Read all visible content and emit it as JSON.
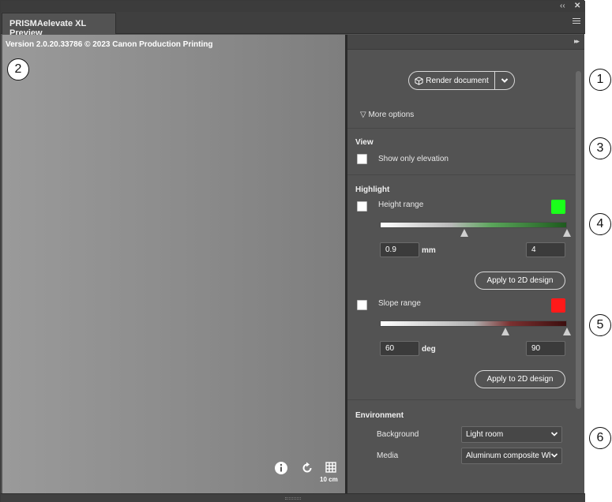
{
  "window": {
    "tab_title": "PRISMAelevate XL Preview",
    "titlebar_buttons": [
      "collapse-icon",
      "close-icon"
    ]
  },
  "preview": {
    "version_text": "Version 2.0.20.33786 © 2023 Canon Production Printing",
    "tool_icons": [
      "info-icon",
      "reset-view-icon",
      "grid-icon"
    ],
    "grid_scale_label": "10 cm"
  },
  "sidebar": {
    "render_button_label": "Render document",
    "more_options_label": "▽ More options",
    "view": {
      "title": "View",
      "show_only_elevation_label": "Show only elevation",
      "show_only_elevation_checked": false
    },
    "highlight": {
      "title": "Highlight",
      "height_range": {
        "label": "Height range",
        "checked": false,
        "color": "#1aff1a",
        "min_value": "0.9",
        "max_value": "4",
        "unit": "mm",
        "apply_label": "Apply to 2D design",
        "slider_min_fraction": 0.45,
        "slider_max_fraction": 1.0
      },
      "slope_range": {
        "label": "Slope range",
        "checked": false,
        "color": "#ff1a1a",
        "min_value": "60",
        "max_value": "90",
        "unit": "deg",
        "apply_label": "Apply to 2D design",
        "slider_min_fraction": 0.67,
        "slider_max_fraction": 1.0
      }
    },
    "environment": {
      "title": "Environment",
      "background_label": "Background",
      "background_value": "Light room",
      "media_label": "Media",
      "media_value": "Aluminum composite Wh"
    }
  },
  "callouts": [
    "1",
    "2",
    "3",
    "4",
    "5",
    "6"
  ]
}
